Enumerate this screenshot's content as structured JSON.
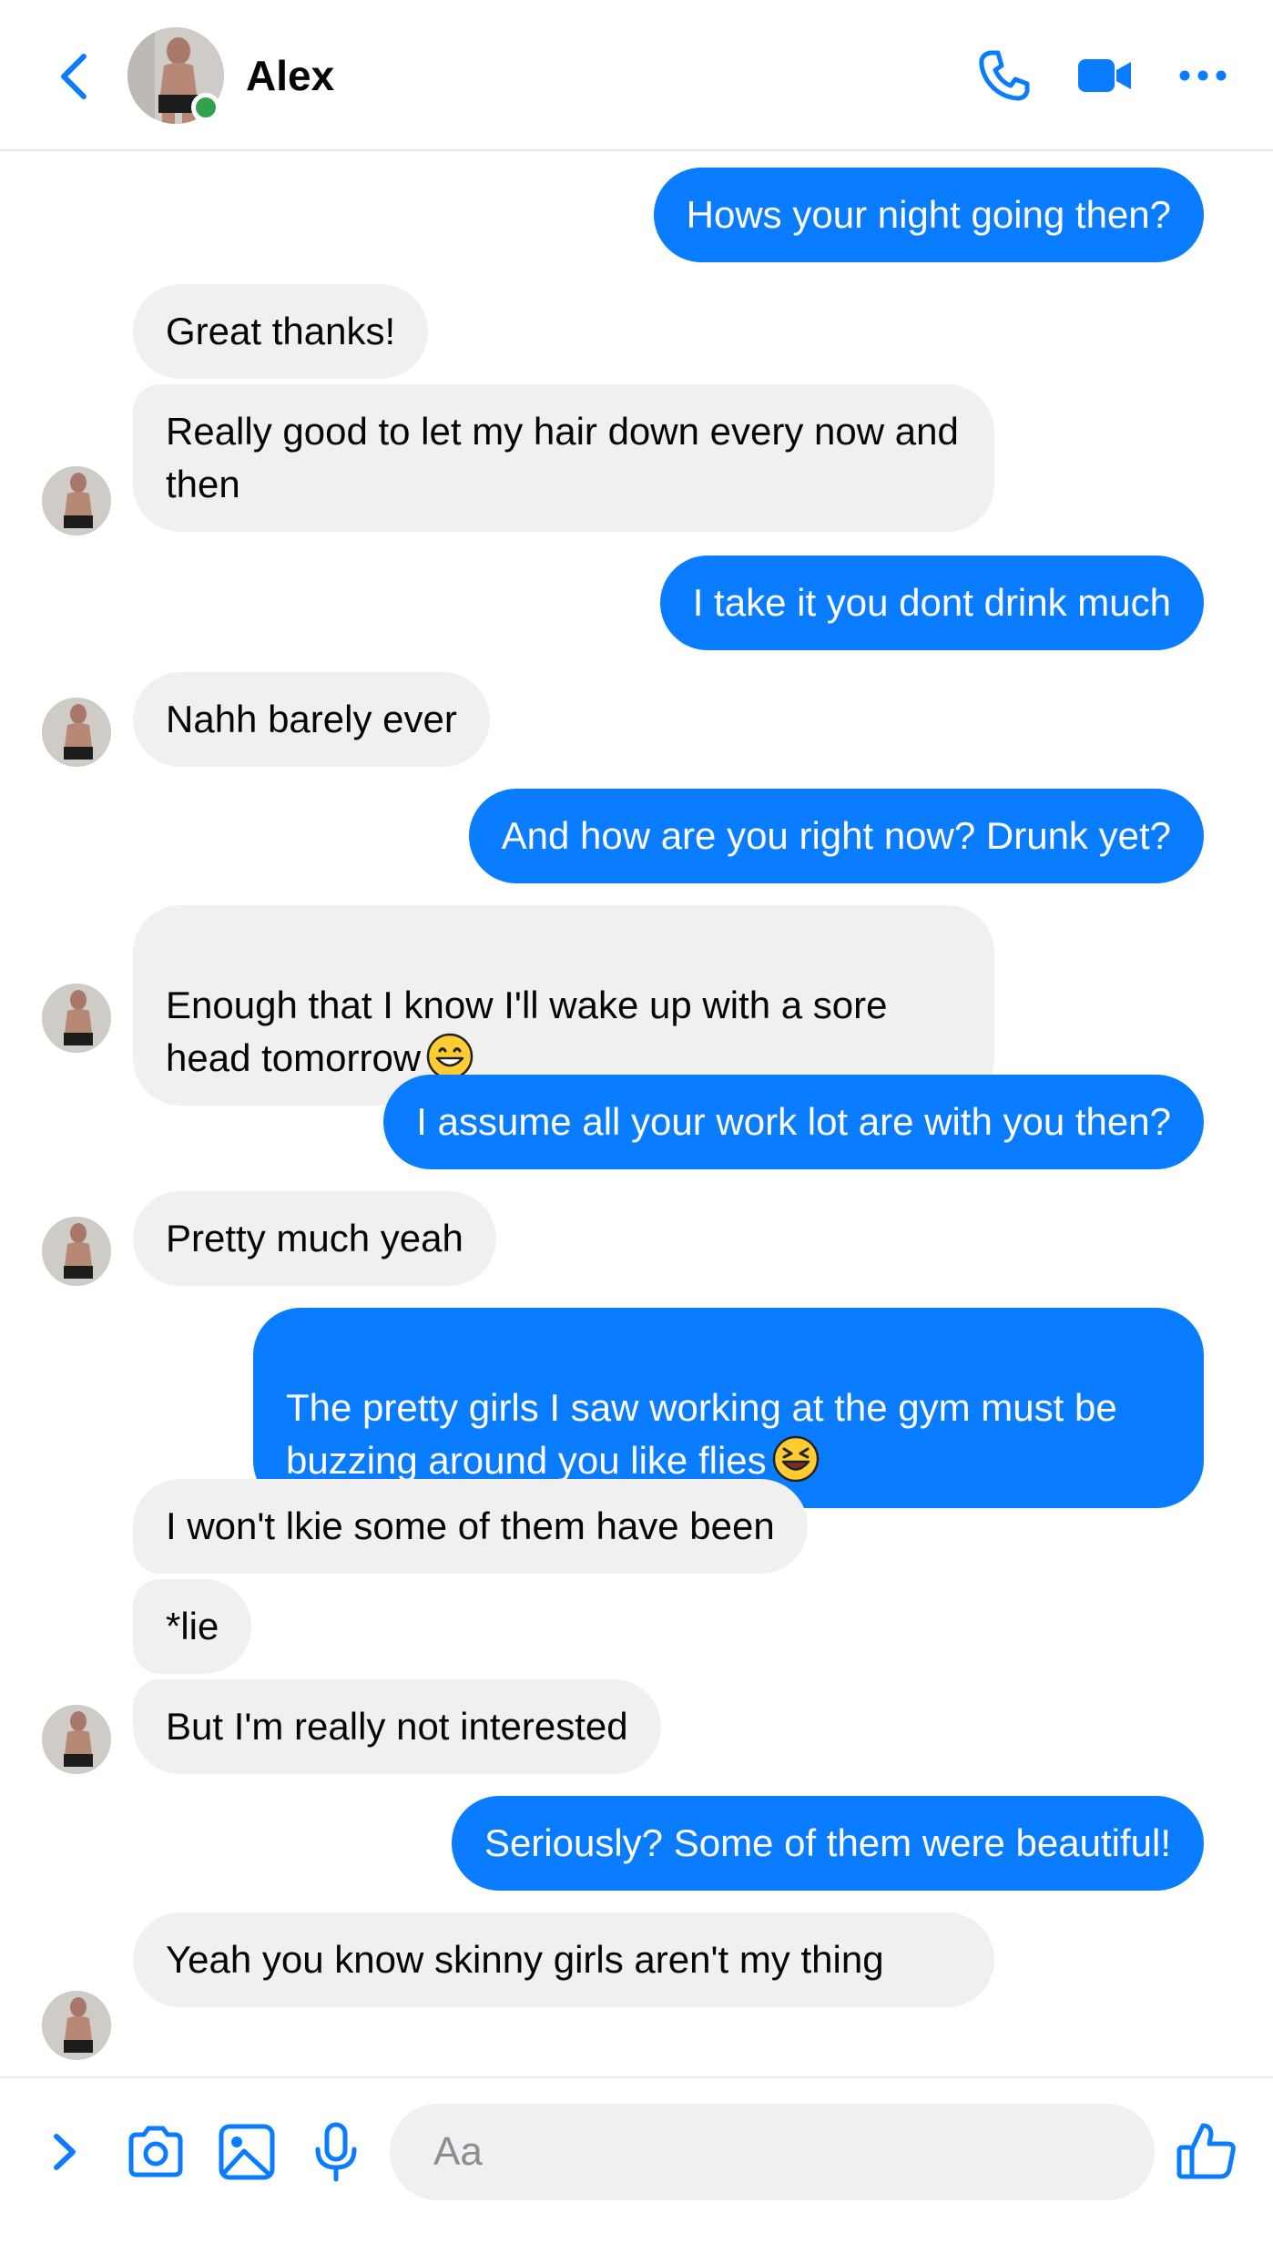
{
  "header": {
    "contact_name": "Alex",
    "online": true,
    "icons": [
      "back-chevron-icon",
      "phone-icon",
      "video-camera-icon",
      "more-options-icon"
    ]
  },
  "messages": [
    {
      "side": "out",
      "text": "Hows your night going then?"
    },
    {
      "side": "in",
      "text": "Great thanks!"
    },
    {
      "side": "in",
      "text": "Really good to let my hair down every now and then"
    },
    {
      "side": "out",
      "text": "I take it you dont drink much"
    },
    {
      "side": "in",
      "text": "Nahh barely ever"
    },
    {
      "side": "out",
      "text": "And how are you right now? Drunk yet?"
    },
    {
      "side": "in",
      "text": "Enough that I know I'll wake up with a sore head tomorrow",
      "emoji": "grinning-face"
    },
    {
      "side": "out",
      "text": "I assume all your work lot are with you then?"
    },
    {
      "side": "in",
      "text": "Pretty much yeah"
    },
    {
      "side": "out",
      "text": "The pretty girls I saw working at the gym must be buzzing around you like flies",
      "emoji": "laughing-squinting-face"
    },
    {
      "side": "in",
      "text": "I won't lkie some of them have been"
    },
    {
      "side": "in",
      "text": "*lie"
    },
    {
      "side": "in",
      "text": "But I'm really not interested"
    },
    {
      "side": "out",
      "text": "Seriously? Some of them were beautiful!"
    },
    {
      "side": "in",
      "text": "Yeah you know skinny girls aren't my thing"
    }
  ],
  "composer": {
    "placeholder": "Aa",
    "icons": [
      "expand-chevron-icon",
      "camera-icon",
      "gallery-icon",
      "microphone-icon",
      "thumbs-up-icon"
    ]
  },
  "colors": {
    "accent": "#0a7cff",
    "incoming_bubble": "#f0f0f0",
    "online": "#31a24c"
  }
}
